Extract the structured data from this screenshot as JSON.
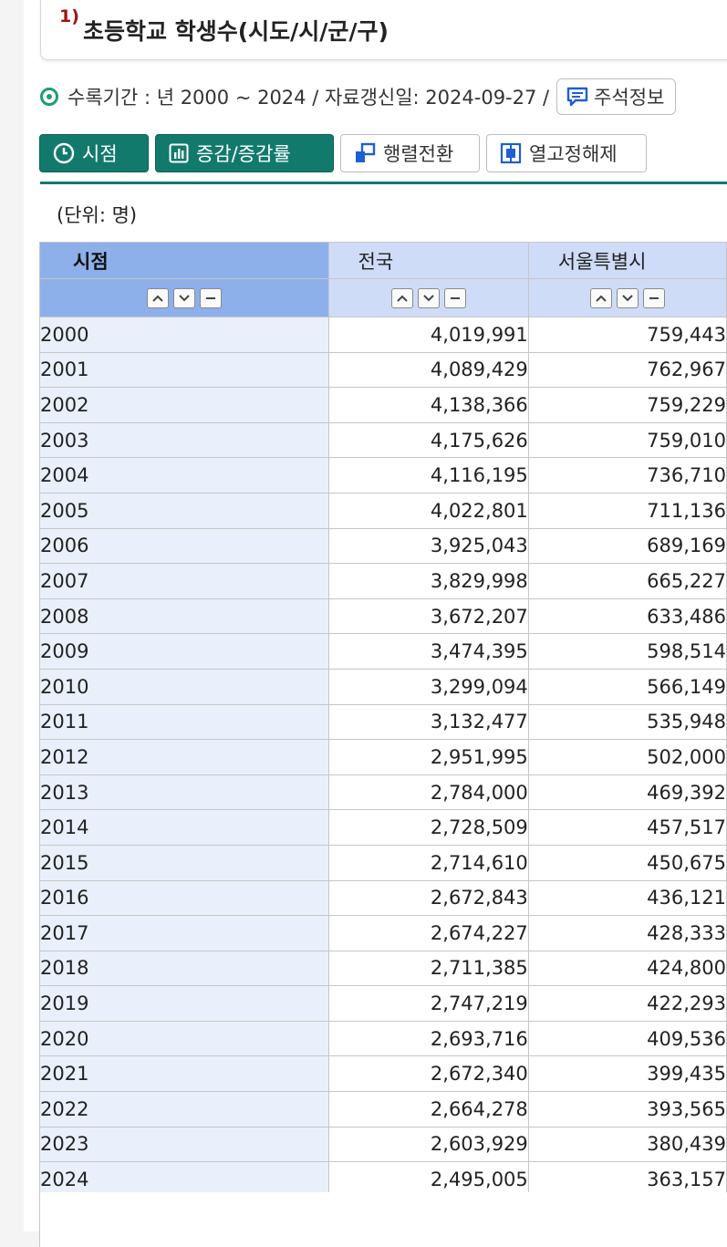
{
  "title": {
    "sup": "1)",
    "text": "초등학교 학생수(시도/시/군/구)"
  },
  "meta": {
    "period_text": "수록기간 : 년 2000 ~ 2024 / 자료갱신일: 2024-09-27 /",
    "note_button": "주석정보"
  },
  "toolbar": {
    "time_button": "시점",
    "change_button": "증감/증감률",
    "pivot_button": "행렬전환",
    "unfix_button": "열고정해제"
  },
  "unit": "(단위: 명)",
  "table": {
    "headers": [
      "시점",
      "전국",
      "서울특별시"
    ],
    "rows": [
      [
        "2000",
        "4,019,991",
        "759,443"
      ],
      [
        "2001",
        "4,089,429",
        "762,967"
      ],
      [
        "2002",
        "4,138,366",
        "759,229"
      ],
      [
        "2003",
        "4,175,626",
        "759,010"
      ],
      [
        "2004",
        "4,116,195",
        "736,710"
      ],
      [
        "2005",
        "4,022,801",
        "711,136"
      ],
      [
        "2006",
        "3,925,043",
        "689,169"
      ],
      [
        "2007",
        "3,829,998",
        "665,227"
      ],
      [
        "2008",
        "3,672,207",
        "633,486"
      ],
      [
        "2009",
        "3,474,395",
        "598,514"
      ],
      [
        "2010",
        "3,299,094",
        "566,149"
      ],
      [
        "2011",
        "3,132,477",
        "535,948"
      ],
      [
        "2012",
        "2,951,995",
        "502,000"
      ],
      [
        "2013",
        "2,784,000",
        "469,392"
      ],
      [
        "2014",
        "2,728,509",
        "457,517"
      ],
      [
        "2015",
        "2,714,610",
        "450,675"
      ],
      [
        "2016",
        "2,672,843",
        "436,121"
      ],
      [
        "2017",
        "2,674,227",
        "428,333"
      ],
      [
        "2018",
        "2,711,385",
        "424,800"
      ],
      [
        "2019",
        "2,747,219",
        "422,293"
      ],
      [
        "2020",
        "2,693,716",
        "409,536"
      ],
      [
        "2021",
        "2,672,340",
        "399,435"
      ],
      [
        "2022",
        "2,664,278",
        "393,565"
      ],
      [
        "2023",
        "2,603,929",
        "380,439"
      ],
      [
        "2024",
        "2,495,005",
        "363,157"
      ]
    ]
  },
  "colors": {
    "primary_green": "#127a6d",
    "header_year_bg": "#8db0ea",
    "header_col_bg": "#cfdcf7",
    "year_cell_bg": "#e9f0fb",
    "title_sup": "#a01414"
  }
}
